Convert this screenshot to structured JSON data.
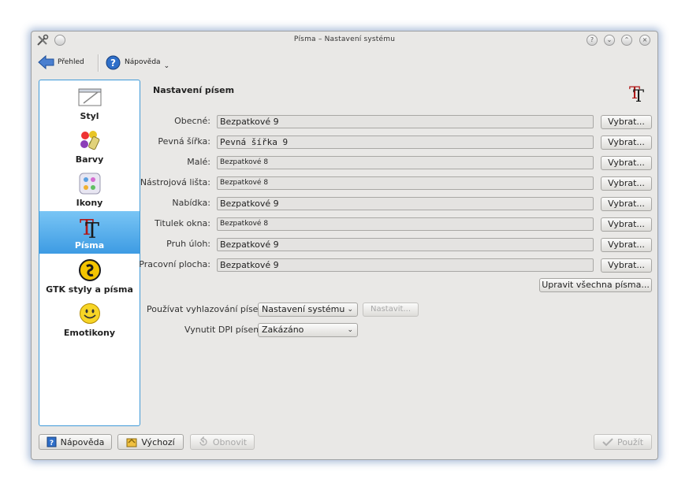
{
  "window": {
    "title": "Písma – Nastavení systému"
  },
  "toolbar": {
    "overview_label": "Přehled",
    "help_label": "Nápověda"
  },
  "sidebar": {
    "items": [
      {
        "label": "Styl",
        "icon": "style-icon"
      },
      {
        "label": "Barvy",
        "icon": "colors-icon"
      },
      {
        "label": "Ikony",
        "icon": "icons-icon"
      },
      {
        "label": "Písma",
        "icon": "fonts-icon",
        "active": true
      },
      {
        "label": "GTK styly a písma",
        "icon": "gtk-icon"
      },
      {
        "label": "Emotikony",
        "icon": "emoticons-icon"
      }
    ]
  },
  "content": {
    "title": "Nastavení písem",
    "rows": [
      {
        "label": "Obecné:",
        "value": "Bezpatkové 9",
        "button": "Vybrat..."
      },
      {
        "label": "Pevná šířka:",
        "value": "Pevná šířka 9",
        "button": "Vybrat..."
      },
      {
        "label": "Malé:",
        "value": "Bezpatkové 8",
        "button": "Vybrat..."
      },
      {
        "label": "Nástrojová lišta:",
        "value": "Bezpatkové 8",
        "button": "Vybrat..."
      },
      {
        "label": "Nabídka:",
        "value": "Bezpatkové 9",
        "button": "Vybrat..."
      },
      {
        "label": "Titulek okna:",
        "value": "Bezpatkové 8",
        "button": "Vybrat..."
      },
      {
        "label": "Pruh úloh:",
        "value": "Bezpatkové 9",
        "button": "Vybrat..."
      },
      {
        "label": "Pracovní plocha:",
        "value": "Bezpatkové 9",
        "button": "Vybrat..."
      }
    ],
    "adjust_all_label": "Upravit všechna písma...",
    "antialias": {
      "label": "Používat vyhlazování písem:",
      "value": "Nastavení systému",
      "configure_label": "Nastavit..."
    },
    "dpi": {
      "label": "Vynutit DPI písem:",
      "value": "Zakázáno"
    }
  },
  "footer": {
    "help_label": "Nápověda",
    "defaults_label": "Výchozí",
    "reset_label": "Obnovit",
    "apply_label": "Použít"
  },
  "colors": {
    "accent": "#3d9be3",
    "window_bg": "#e9e8e6"
  }
}
